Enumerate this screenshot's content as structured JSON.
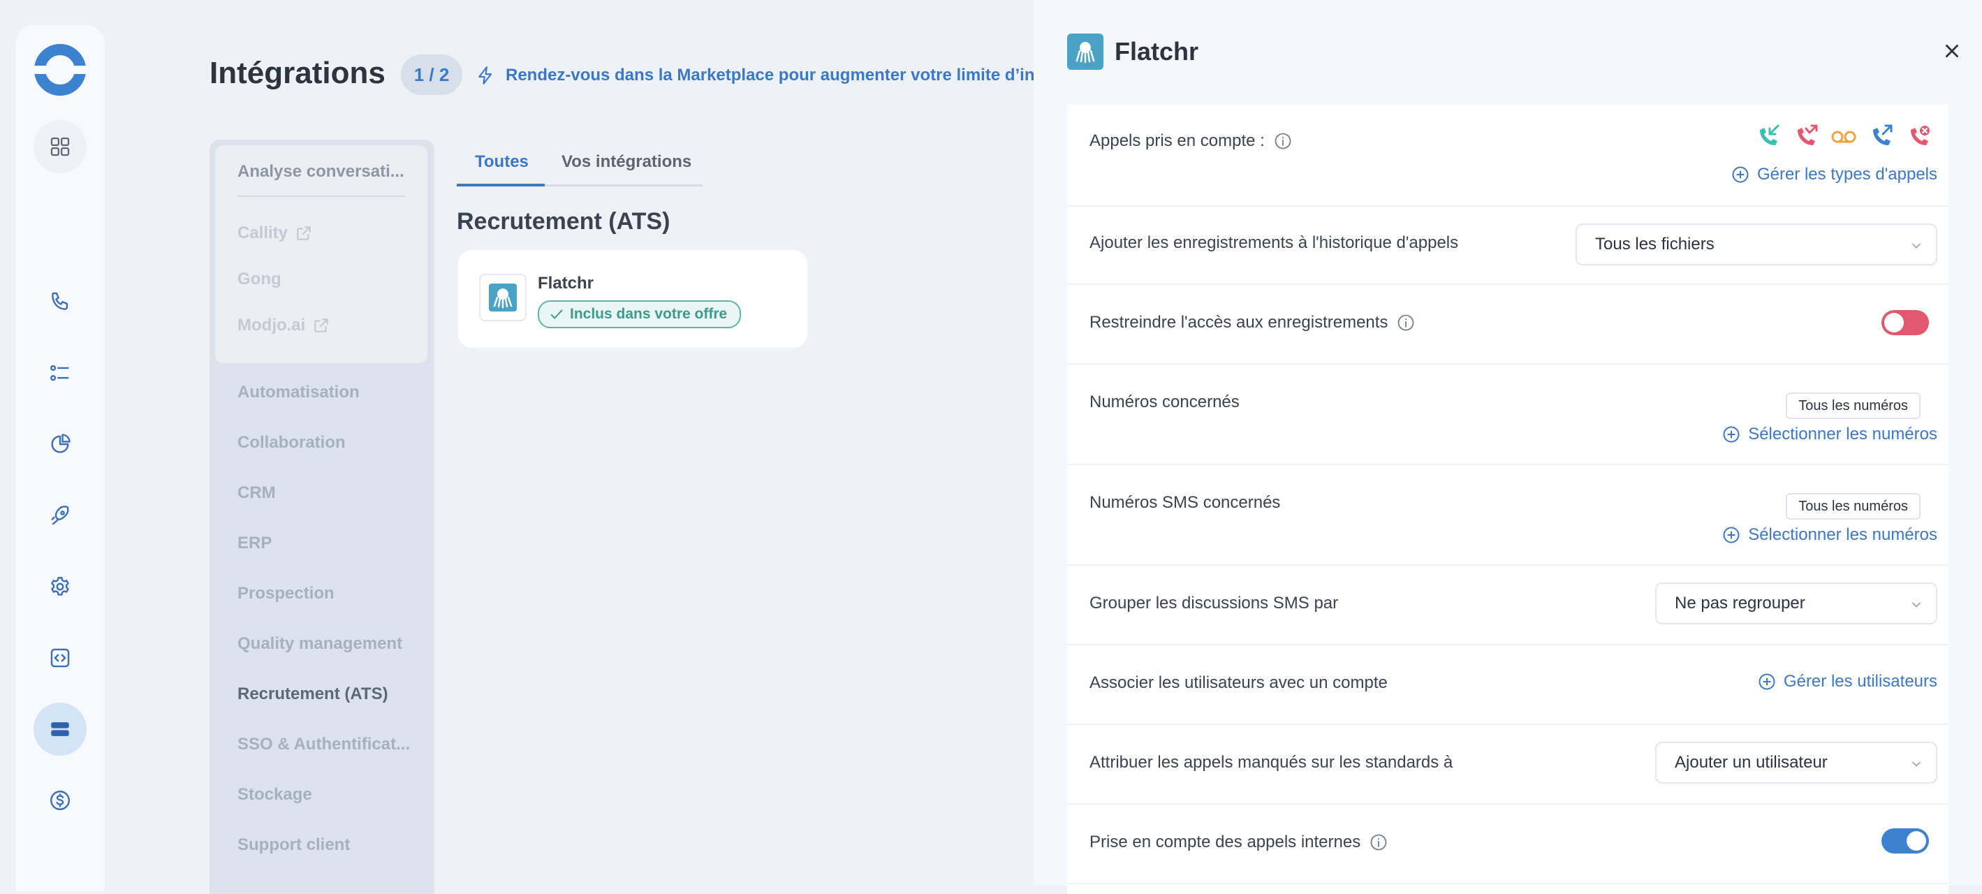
{
  "colors": {
    "accent": "#3c78c8",
    "success": "#3f9a8c",
    "toggle_off": "#e2596f",
    "toggle_on": "#3c82d0",
    "call_teal": "#3bbfb0",
    "call_red": "#e2596f",
    "call_orange": "#f0a13a",
    "call_blue": "#3c82d0"
  },
  "rail": {
    "items": [
      {
        "icon": "logo-icon"
      },
      {
        "icon": "grid-icon"
      },
      {
        "icon": "phone-icon"
      },
      {
        "icon": "list-icon"
      },
      {
        "icon": "pie-chart-icon"
      },
      {
        "icon": "rocket-icon"
      },
      {
        "icon": "gear-icon"
      },
      {
        "icon": "code-icon"
      },
      {
        "icon": "integrations-icon",
        "active": true
      },
      {
        "icon": "dollar-icon"
      }
    ]
  },
  "header": {
    "title": "Intégrations",
    "count": "1 / 2",
    "marketplace_text": "Rendez-vous dans la Marketplace pour augmenter votre limite d’intég"
  },
  "categories": {
    "group_title": "Analyse conversati...",
    "group_items": [
      "Callity",
      "Gong",
      "Modjo.ai"
    ],
    "items": [
      "Automatisation",
      "Collaboration",
      "CRM",
      "ERP",
      "Prospection",
      "Quality management",
      "Recrutement (ATS)",
      "SSO & Authentificat...",
      "Stockage",
      "Support client"
    ],
    "selected": "Recrutement (ATS)"
  },
  "tabs": [
    "Toutes",
    "Vos intégrations"
  ],
  "section": {
    "title": "Recrutement (ATS)",
    "card_name": "Flatchr",
    "card_badge": "Inclus dans votre offre"
  },
  "drawer": {
    "title": "Flatchr",
    "rows": {
      "calls_label": "Appels pris en compte :",
      "calls_link": "Gérer les types d'appels",
      "recordings_label": "Ajouter les enregistrements à l'historique d'appels",
      "recordings_value": "Tous les fichiers",
      "restrict_label": "Restreindre l'accès aux enregistrements",
      "restrict_on": false,
      "numbers_label": "Numéros concernés",
      "numbers_chip": "Tous les numéros",
      "numbers_link": "Sélectionner les numéros",
      "sms_label": "Numéros SMS concernés",
      "sms_chip": "Tous les numéros",
      "sms_link": "Sélectionner les numéros",
      "group_label": "Grouper les discussions SMS par",
      "group_value": "Ne pas regrouper",
      "assoc_label": "Associer les utilisateurs avec un compte",
      "assoc_link": "Gérer les utilisateurs",
      "missed_label": "Attribuer les appels manqués sur les standards à",
      "missed_value": "Ajouter un utilisateur",
      "internal_label": "Prise en compte des appels internes",
      "internal_on": true
    }
  }
}
